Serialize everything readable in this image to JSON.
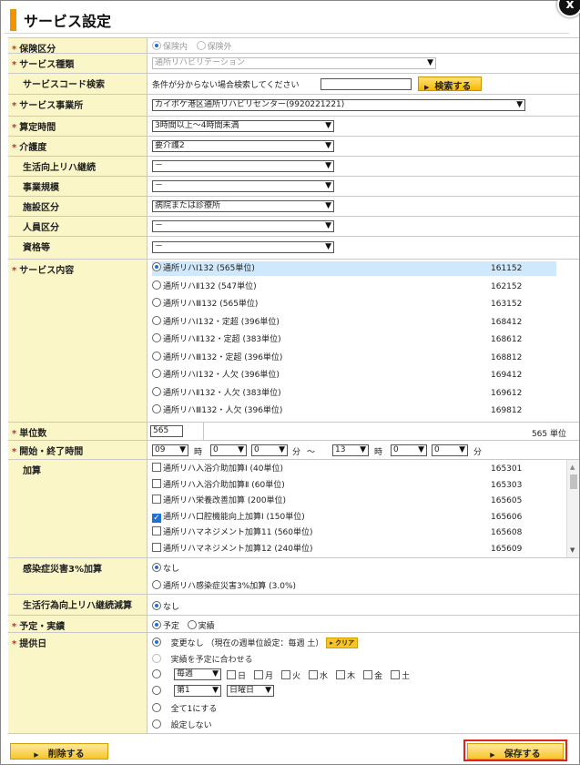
{
  "title": "サービス設定",
  "close_label": "x",
  "insurance": {
    "label": "保険区分",
    "options": [
      "保険内",
      "保険外"
    ]
  },
  "service_type": {
    "label": "サービス種類",
    "value": "通所リハビリテーション"
  },
  "service_code_search": {
    "label": "サービスコード検索",
    "hint": "条件が分からない場合検索してください",
    "button": "検索する"
  },
  "provider": {
    "label": "サービス事業所",
    "value": "カイポケ港区通所リハビリセンター(9920221221)"
  },
  "calc_time": {
    "label": "算定時間",
    "value": "3時間以上～4時間未満"
  },
  "care_level": {
    "label": "介護度",
    "value": "要介護2"
  },
  "life_rehab": {
    "label": "生活向上リハ継続",
    "value": "－"
  },
  "scale": {
    "label": "事業規模",
    "value": "－"
  },
  "facility": {
    "label": "施設区分",
    "value": "病院または診療所"
  },
  "staff": {
    "label": "人員区分",
    "value": "－"
  },
  "qualification": {
    "label": "資格等",
    "value": "－"
  },
  "service_content": {
    "label": "サービス内容",
    "items": [
      {
        "name": "通所リハⅠ132 (565単位)",
        "code": "161152"
      },
      {
        "name": "通所リハⅡ132 (547単位)",
        "code": "162152"
      },
      {
        "name": "通所リハⅢ132 (565単位)",
        "code": "163152"
      },
      {
        "name": "通所リハⅠ132・定超 (396単位)",
        "code": "168412"
      },
      {
        "name": "通所リハⅡ132・定超 (383単位)",
        "code": "168612"
      },
      {
        "name": "通所リハⅢ132・定超 (396単位)",
        "code": "168812"
      },
      {
        "name": "通所リハⅠ132・人欠 (396単位)",
        "code": "169412"
      },
      {
        "name": "通所リハⅡ132・人欠 (383単位)",
        "code": "169612"
      },
      {
        "name": "通所リハⅢ132・人欠 (396単位)",
        "code": "169812"
      }
    ]
  },
  "units": {
    "label": "単位数",
    "value": "565",
    "display": "565 単位"
  },
  "time": {
    "label": "開始・終了時間",
    "start_h": "09",
    "start_m1": "0",
    "start_m2": "0",
    "end_h": "13",
    "end_m1": "0",
    "end_m2": "0",
    "hour_unit": "時",
    "min_unit": "分",
    "tilde": "～"
  },
  "addition": {
    "label": "加算",
    "items": [
      {
        "name": "通所リハ入浴介助加算Ⅰ (40単位)",
        "code": "165301"
      },
      {
        "name": "通所リハ入浴介助加算Ⅱ (60単位)",
        "code": "165303"
      },
      {
        "name": "通所リハ栄養改善加算 (200単位)",
        "code": "165605"
      },
      {
        "name": "通所リハ口腔機能向上加算Ⅰ (150単位)",
        "code": "165606"
      },
      {
        "name": "通所リハマネジメント加算11 (560単位)",
        "code": "165608"
      },
      {
        "name": "通所リハマネジメント加算12 (240単位)",
        "code": "165609"
      }
    ]
  },
  "infection": {
    "label": "感染症災害3%加算",
    "options": [
      "なし",
      "通所リハ感染症災害3%加算 (3.0%)"
    ]
  },
  "life_reduction": {
    "label": "生活行為向上リハ継続減算",
    "option": "なし"
  },
  "plan_actual": {
    "label": "予定・実績",
    "options": [
      "予定",
      "実績"
    ]
  },
  "provision": {
    "label": "提供日",
    "opt1": "変更なし （現在の週単位設定：毎週 土）",
    "clear": "クリア",
    "opt2": "実績を予定に合わせる",
    "week_value": "毎週",
    "days": [
      "日",
      "月",
      "火",
      "水",
      "木",
      "金",
      "土"
    ],
    "nth_value": "第1",
    "weekday_value": "日曜日",
    "opt5": "全て1にする",
    "opt6": "設定しない"
  },
  "footer": {
    "delete": "削除する",
    "save": "保存する"
  }
}
